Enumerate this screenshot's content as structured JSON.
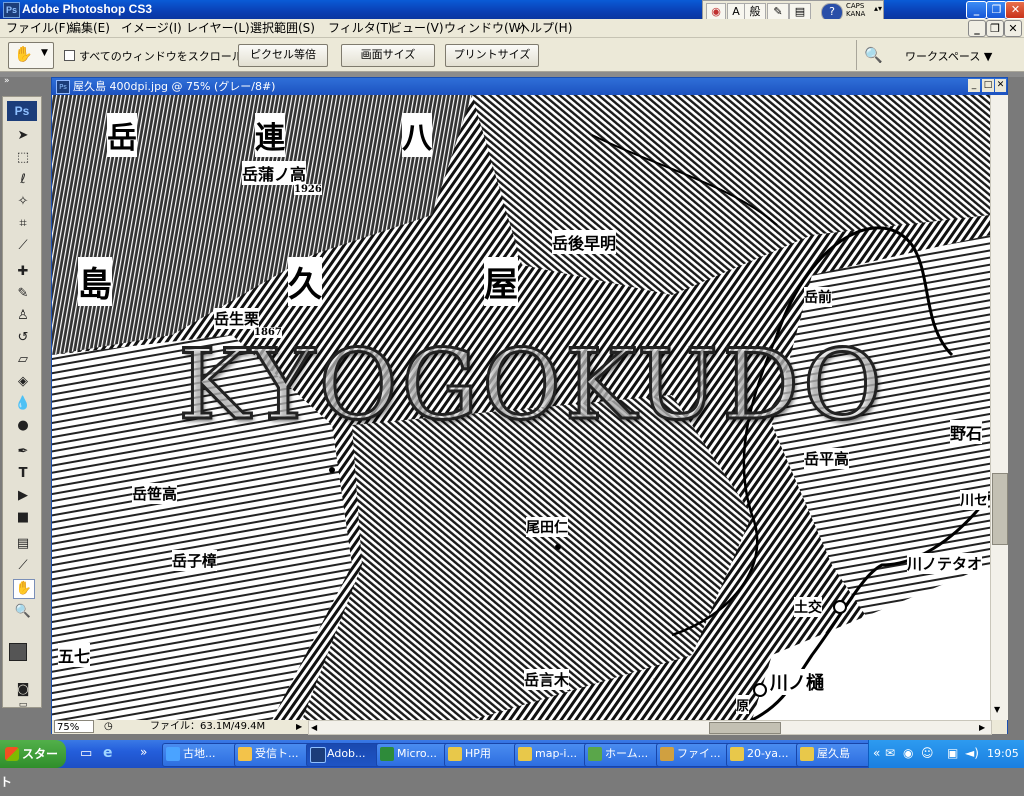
{
  "app": {
    "title": "Adobe Photoshop CS3",
    "window_buttons": [
      "_",
      "❐",
      "✕"
    ]
  },
  "ime_bar": {
    "items": [
      "A",
      "般"
    ],
    "caps": "CAPS",
    "kana": "KANA"
  },
  "menu": [
    "ファイル(F)",
    "編集(E)",
    "イメージ(I)",
    "レイヤー(L)",
    "選択範囲(S)",
    "フィルタ(T)",
    "ビュー(V)",
    "ウィンドウ(W)",
    "ヘルプ(H)"
  ],
  "options": {
    "scroll_all_windows": "すべてのウィンドウをスクロール",
    "scroll_all_checked": false,
    "actual_pixels": "ピクセル等倍",
    "fit_screen": "画面サイズ",
    "print_size": "プリントサイズ",
    "workspace": "ワークスペース"
  },
  "document": {
    "title": "屋久島 400dpi.jpg @ 75% (グレー/8#)",
    "zoom": "75%",
    "file_info": "ファイル：63.1M/49.4M"
  },
  "map": {
    "watermark": "KYOGOKUDO",
    "labels": {
      "l1": "岳",
      "l2": "連",
      "l3": "八",
      "l4": "岳蒲ノ高",
      "l5": "1926",
      "l6": "岳後早明",
      "l7": "島",
      "l8": "久",
      "l9": "屋",
      "l10": "岳前",
      "l11": "岳生栗",
      "l12": "1867",
      "l13": "岳平高",
      "l14": "野石",
      "l15": "岳笹高",
      "l16": "岳子樟",
      "l17": "尾田仁",
      "l18": "川ノテタオ",
      "l19": "土交",
      "l20": "川ノ樋",
      "l21": "岳言木",
      "l22": "五七",
      "l23": "原",
      "l24": "川セ"
    }
  },
  "taskbar": {
    "start": "スタート",
    "tasks": [
      "古地...",
      "受信ト...",
      "Adob...",
      "Micro...",
      "HP用",
      "map-i...",
      "ホーム...",
      "ファイ...",
      "20-ya...",
      "屋久島"
    ],
    "clock": "19:05"
  },
  "colors": {
    "xp_blue": "#0a3fb4",
    "taskbar_blue": "#245edb",
    "start_green": "#3a9a34",
    "chrome": "#ece9d8"
  }
}
